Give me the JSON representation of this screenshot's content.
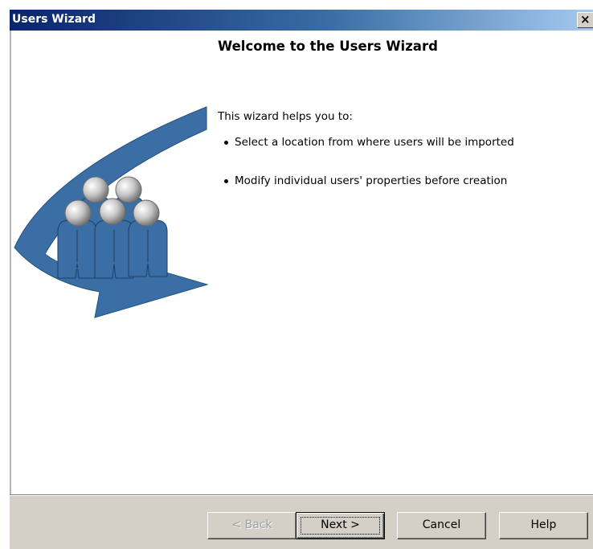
{
  "window": {
    "title": "Users Wizard",
    "close_glyph": "×"
  },
  "content": {
    "heading": "Welcome to the Users Wizard",
    "intro": "This wizard helps you to:",
    "bullets": [
      "Select a location from where users will be imported",
      "Modify individual users' properties before creation"
    ],
    "illustration": "users-arrow-icon"
  },
  "buttons": {
    "back": "< Back",
    "next": "Next >",
    "cancel": "Cancel",
    "help": "Help"
  },
  "colors": {
    "titlebar_start": "#0a246a",
    "arrow_blue": "#3a6ea5",
    "dialog_gray": "#d4d0c8"
  }
}
